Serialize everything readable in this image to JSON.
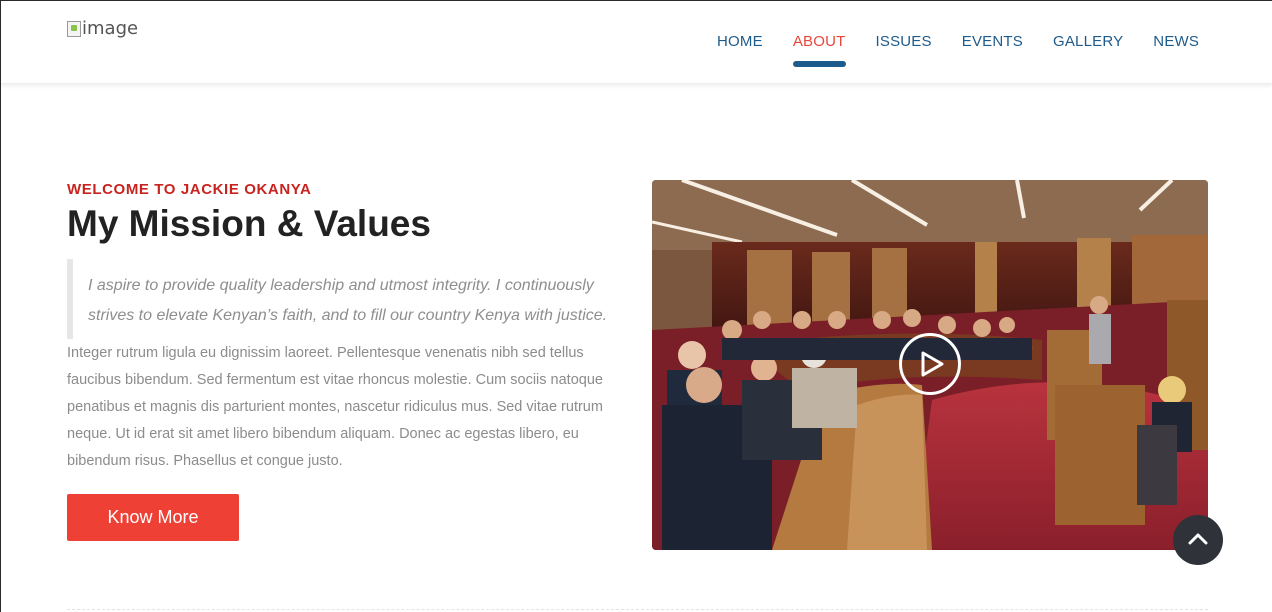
{
  "header": {
    "logo_alt": "image",
    "nav": [
      {
        "label": "HOME",
        "active": false
      },
      {
        "label": "ABOUT",
        "active": true
      },
      {
        "label": "ISSUES",
        "active": false
      },
      {
        "label": "EVENTS",
        "active": false
      },
      {
        "label": "GALLERY",
        "active": false
      },
      {
        "label": "NEWS",
        "active": false
      }
    ]
  },
  "about": {
    "eyebrow": "WELCOME TO JACKIE OKANYA",
    "title": "My Mission & Values",
    "quote": "I aspire to provide quality leadership and utmost integrity. I continuously strives to elevate Kenyan’s faith, and to fill our country Kenya with justice.",
    "body": "Integer rutrum ligula eu dignissim laoreet. Pellentesque venenatis nibh sed tellus faucibus bibendum. Sed fermentum est vitae rhoncus molestie. Cum sociis natoque penatibus et magnis dis parturient montes, nascetur ridiculus mus. Sed vitae rutrum neque. Ut id erat sit amet libero bibendum aliquam. Donec ac egestas libero, eu bibendum risus. Phasellus et congue justo.",
    "button_label": "Know More"
  },
  "media": {
    "video_thumbnail": "assembly chamber photo",
    "play_icon": "play-icon"
  },
  "scroll_top_icon": "chevron-up-icon",
  "colors": {
    "accent_red": "#ee4035",
    "eyebrow_red": "#c8241f",
    "nav_blue": "#1d5b8c",
    "active_nav": "#e8463b"
  }
}
